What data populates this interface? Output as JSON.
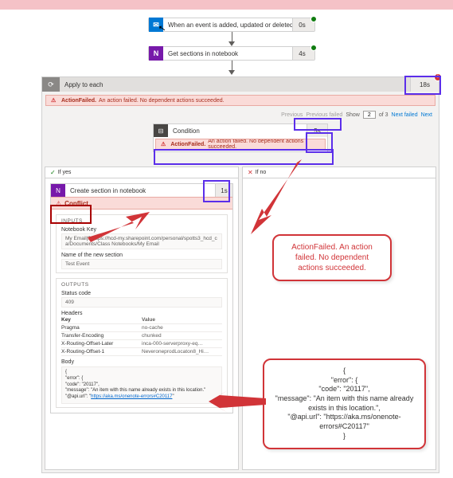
{
  "trigger": {
    "icon": "outlook-icon",
    "label": "When an event is added, updated or deleted",
    "timing": "0s"
  },
  "action_get_sections": {
    "icon": "onenote-icon",
    "label": "Get sections in notebook",
    "timing": "4s"
  },
  "apply_to_each": {
    "label": "Apply to each",
    "timing": "18s",
    "error_badge": "!",
    "error_banner": {
      "title": "ActionFailed.",
      "text": "An action failed. No dependent actions succeeded."
    },
    "pager": {
      "prev": "Previous",
      "prev_failed": "Previous failed",
      "show_label": "Show",
      "show_value": "2",
      "of_text": "of 3",
      "next_failed": "Next failed",
      "next": "Next"
    }
  },
  "condition": {
    "label": "Condition",
    "timing": "5s",
    "error_banner": {
      "title": "ActionFailed.",
      "text": "An action failed. No dependent actions succeeded."
    }
  },
  "branches": {
    "yes": "If yes",
    "no": "If no"
  },
  "create_section": {
    "label": "Create section in notebook",
    "timing": "1s",
    "conflict_label": "Conflict"
  },
  "inputs": {
    "title": "INPUTS",
    "notebook_key": {
      "label": "Notebook Key",
      "value": "My Email|$|https://hcd-my.sharepoint.com/personal/spotts3_hcd_ca/Documents/Class Notebooks/My Email"
    },
    "section_name": {
      "label": "Name of the new section",
      "value": "Test Event"
    }
  },
  "outputs": {
    "title": "OUTPUTS",
    "status_code": {
      "label": "Status code",
      "value": "409"
    },
    "headers": {
      "label": "Headers",
      "key_col": "Key",
      "val_col": "Value",
      "rows": [
        {
          "k": "Pragma",
          "v": "no-cache"
        },
        {
          "k": "Transfer-Encoding",
          "v": "chunked"
        },
        {
          "k": "X-Routing-Offset-Later",
          "v": "inca-000-serverproxy-eq…"
        },
        {
          "k": "X-Routing-Offset-1",
          "v": "NeveroneprodLocaton8_Hi…"
        }
      ]
    },
    "body": {
      "label": "Body",
      "lines": {
        "l0": "{",
        "l1": "  \"error\": {",
        "l2": "    \"code\": \"20117\",",
        "l3a": "    \"message\": \"An item with this name already exists in this location.\"",
        "l4a": "    \"@api.url\": \"",
        "l4b": "https://aka.ms/onenote-errors#C20117",
        "l4c": "\""
      }
    }
  },
  "callouts": {
    "c1": "ActionFailed. An action failed. No dependent actions succeeded.",
    "c2": {
      "l0": "{",
      "l1": "\"error\": {",
      "l2": "\"code\": \"20117\",",
      "l3": "\"message\": \"An item with this name already exists in this location.\",",
      "l4": "\"@api.url\": \"https://aka.ms/onenote-errors#C20117\"",
      "l5": "}"
    }
  }
}
